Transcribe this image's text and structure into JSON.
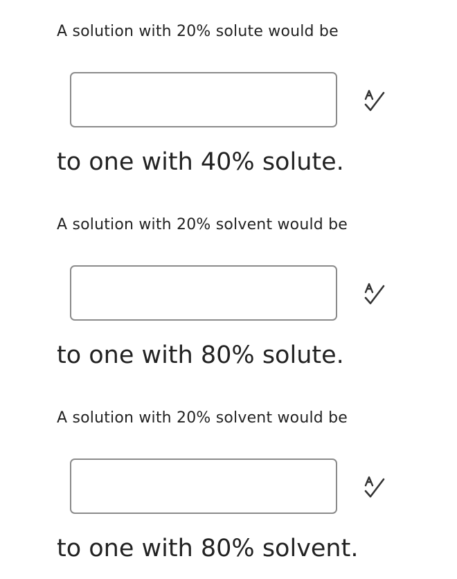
{
  "questions": [
    {
      "prompt": "A solution with 20% solute would be",
      "answer_value": "",
      "answer_placeholder": "",
      "suffix": "to one with 40% solute.",
      "icon": "spell-check-icon"
    },
    {
      "prompt": "A solution with 20% solvent would be",
      "answer_value": "",
      "answer_placeholder": "",
      "suffix": "to one with 80% solute.",
      "icon": "spell-check-icon"
    },
    {
      "prompt": "A solution with 20% solvent would be",
      "answer_value": "",
      "answer_placeholder": "",
      "suffix": "to one with 80% solvent.",
      "icon": "spell-check-icon"
    }
  ],
  "colors": {
    "text": "#222222",
    "box_border": "#8a8a8a",
    "icon": "#333333"
  }
}
